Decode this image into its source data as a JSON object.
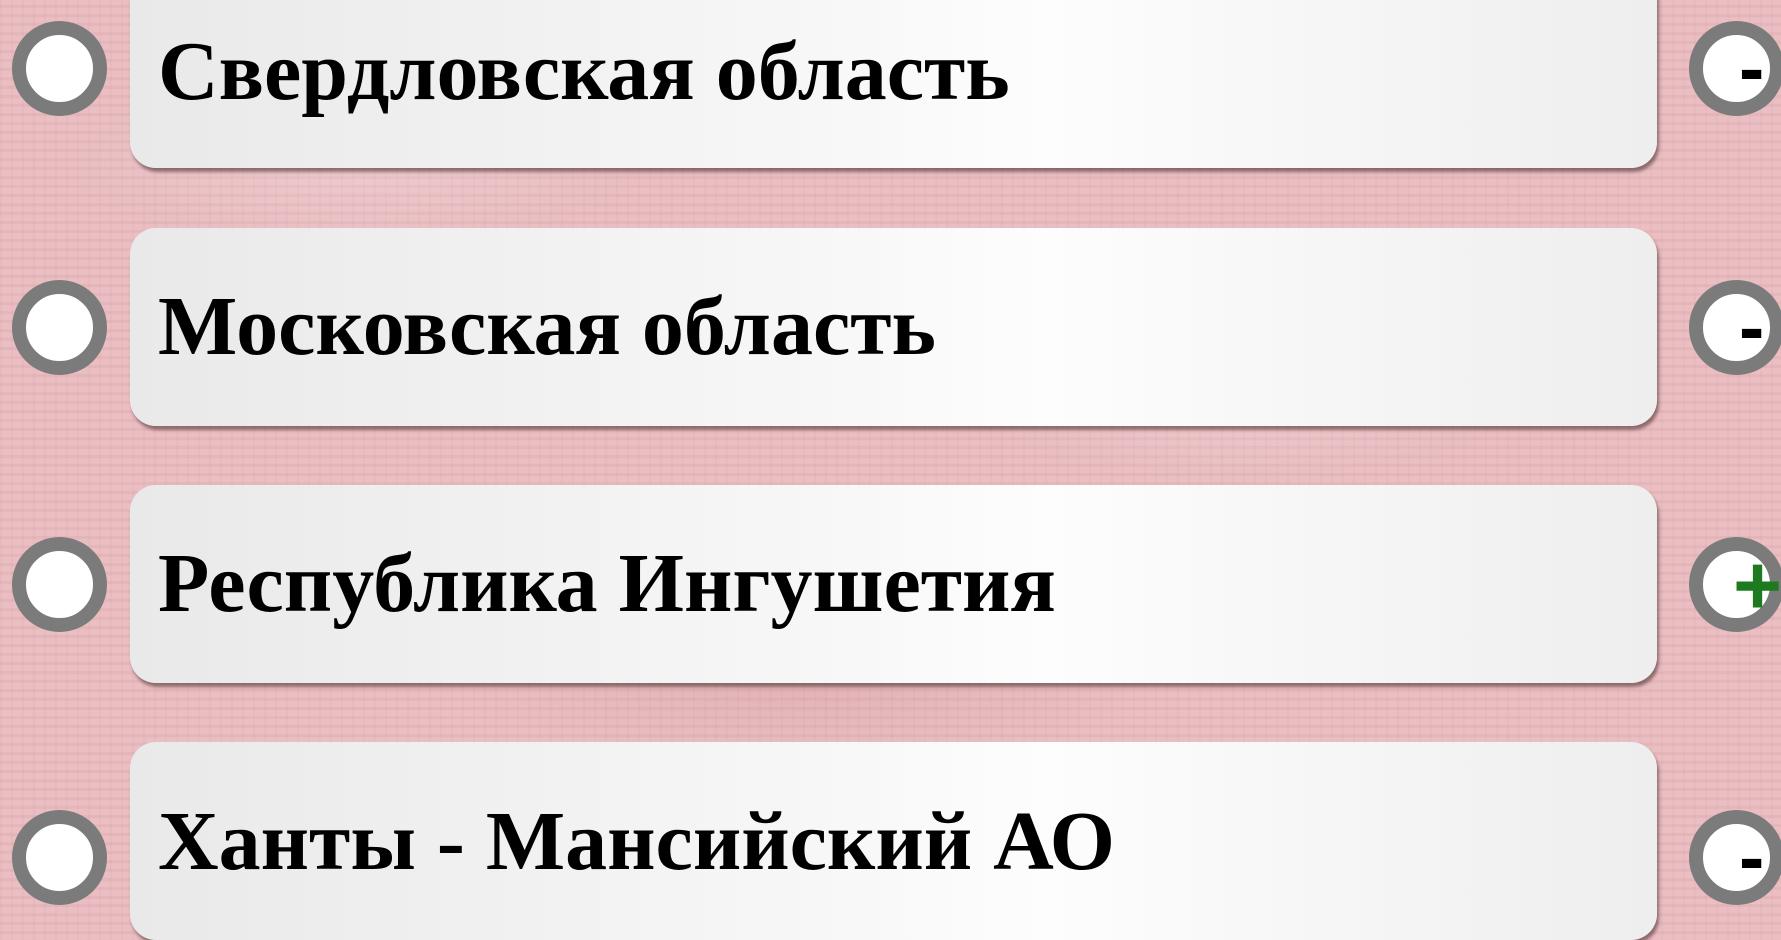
{
  "options": [
    {
      "label": "Свердловская область",
      "mark": "-",
      "mark_icon": "minus-icon",
      "mark_color": "#000000"
    },
    {
      "label": "Московская область",
      "mark": "-",
      "mark_icon": "minus-icon",
      "mark_color": "#000000"
    },
    {
      "label": "Республика Ингушетия",
      "mark": "+",
      "mark_icon": "plus-icon",
      "mark_color": "#1e7a1e"
    },
    {
      "label": "Ханты - Мансийский АО",
      "mark": "-",
      "mark_icon": "minus-icon",
      "mark_color": "#000000"
    }
  ],
  "colors": {
    "background": "#e8b9bd",
    "card": "#f7f7f7",
    "ring": "#7b7b7b",
    "correct": "#1e7a1e"
  }
}
